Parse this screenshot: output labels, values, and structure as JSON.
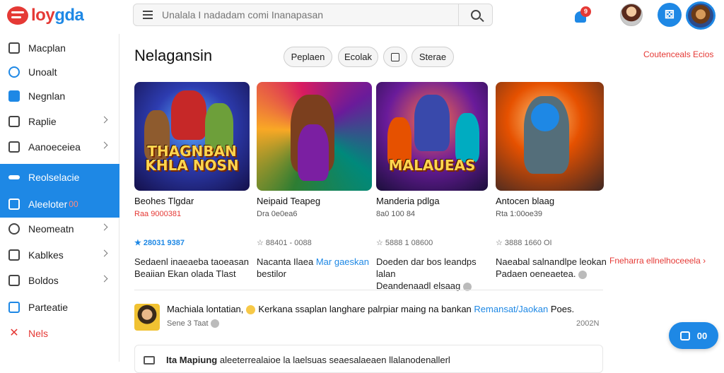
{
  "brand": {
    "name_a": "loy",
    "name_b": "gda"
  },
  "search": {
    "placeholder": "Unalala I nadadam comi Inanapasan"
  },
  "notifications": {
    "badge": "9"
  },
  "sidebar": {
    "items": [
      {
        "label": "Macplan"
      },
      {
        "label": "Unoalt"
      },
      {
        "label": "Negnlan"
      },
      {
        "label": "Raplie"
      },
      {
        "label": "Aanoeceiea"
      },
      {
        "label": "Reolselacie"
      },
      {
        "label": "Aleeloter",
        "badge": "00"
      },
      {
        "label": "Neomeatn"
      },
      {
        "label": "Kablkes"
      },
      {
        "label": "Boldos"
      },
      {
        "label": "Parteatie"
      },
      {
        "label": "Nels"
      }
    ]
  },
  "main": {
    "title": "Nelagansin",
    "chips": [
      {
        "label": "Peplaen"
      },
      {
        "label": "Ecolak"
      },
      {
        "label": ""
      },
      {
        "label": "Sterae"
      }
    ],
    "see_all": "Coutenceals Ecios",
    "more": "Fneharra ellnelhoceeela"
  },
  "cards": [
    {
      "name": "Beohes Tlgdar",
      "meta": "Raa 9000381",
      "rating": "★ 28031 9387",
      "desc_a": "Sedaenl inaeaeba taoeasan",
      "desc_b": "Beaiian Ekan olada Tlast",
      "banner": "THAGNBAN KHLA NOSN"
    },
    {
      "name": "Neipaid Teapeg",
      "meta": "Dra 0e0ea6",
      "rating": "☆ 88401 - 0088",
      "desc_a": "Nacanta Ilaea ",
      "desc_link": "Mar gaeskan",
      "desc_b": "bestilor",
      "banner": ""
    },
    {
      "name": "Manderia pdlga",
      "meta": "8a0 100 84",
      "rating": "☆ 5888 1 08600",
      "desc_a": "Doeden dar bos leandps lalan",
      "desc_b": "Deandenaadl elsaag",
      "banner": "MALAUEAS"
    },
    {
      "name": "Antocen blaag",
      "meta": "Rta 1:00oe39",
      "rating": "☆ 3888 1660 OI",
      "desc_a": "Naeabal salnandlpe leokan",
      "desc_b": "Padaen oeneaetea.",
      "banner": ""
    }
  ],
  "comment": {
    "author": "Machiala lontatian,",
    "text": "Kerkana ssaplan langhare palrpiar maing na bankan",
    "link": "Remansat/Jaokan",
    "tail": "Poes.",
    "meta": "Sene 3 Taat",
    "time": "2002N"
  },
  "next_item": {
    "title": "Ita Mapiung",
    "text": "aleeterrealaioe la laelsuas seaesalaeaen llalanodenallerl"
  },
  "chat_button": {
    "label": "00"
  }
}
